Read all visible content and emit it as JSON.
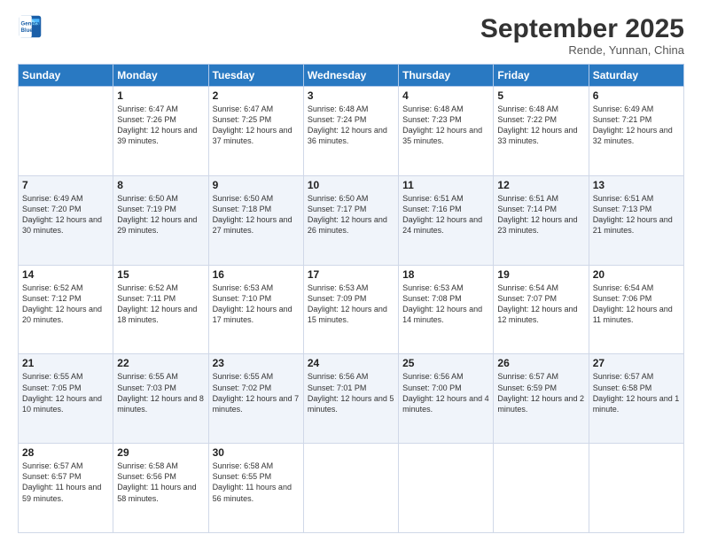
{
  "header": {
    "logo_line1": "General",
    "logo_line2": "Blue",
    "month_title": "September 2025",
    "subtitle": "Rende, Yunnan, China"
  },
  "weekdays": [
    "Sunday",
    "Monday",
    "Tuesday",
    "Wednesday",
    "Thursday",
    "Friday",
    "Saturday"
  ],
  "weeks": [
    [
      {
        "day": "",
        "content": ""
      },
      {
        "day": "1",
        "content": "Sunrise: 6:47 AM\nSunset: 7:26 PM\nDaylight: 12 hours\nand 39 minutes."
      },
      {
        "day": "2",
        "content": "Sunrise: 6:47 AM\nSunset: 7:25 PM\nDaylight: 12 hours\nand 37 minutes."
      },
      {
        "day": "3",
        "content": "Sunrise: 6:48 AM\nSunset: 7:24 PM\nDaylight: 12 hours\nand 36 minutes."
      },
      {
        "day": "4",
        "content": "Sunrise: 6:48 AM\nSunset: 7:23 PM\nDaylight: 12 hours\nand 35 minutes."
      },
      {
        "day": "5",
        "content": "Sunrise: 6:48 AM\nSunset: 7:22 PM\nDaylight: 12 hours\nand 33 minutes."
      },
      {
        "day": "6",
        "content": "Sunrise: 6:49 AM\nSunset: 7:21 PM\nDaylight: 12 hours\nand 32 minutes."
      }
    ],
    [
      {
        "day": "7",
        "content": "Sunrise: 6:49 AM\nSunset: 7:20 PM\nDaylight: 12 hours\nand 30 minutes."
      },
      {
        "day": "8",
        "content": "Sunrise: 6:50 AM\nSunset: 7:19 PM\nDaylight: 12 hours\nand 29 minutes."
      },
      {
        "day": "9",
        "content": "Sunrise: 6:50 AM\nSunset: 7:18 PM\nDaylight: 12 hours\nand 27 minutes."
      },
      {
        "day": "10",
        "content": "Sunrise: 6:50 AM\nSunset: 7:17 PM\nDaylight: 12 hours\nand 26 minutes."
      },
      {
        "day": "11",
        "content": "Sunrise: 6:51 AM\nSunset: 7:16 PM\nDaylight: 12 hours\nand 24 minutes."
      },
      {
        "day": "12",
        "content": "Sunrise: 6:51 AM\nSunset: 7:14 PM\nDaylight: 12 hours\nand 23 minutes."
      },
      {
        "day": "13",
        "content": "Sunrise: 6:51 AM\nSunset: 7:13 PM\nDaylight: 12 hours\nand 21 minutes."
      }
    ],
    [
      {
        "day": "14",
        "content": "Sunrise: 6:52 AM\nSunset: 7:12 PM\nDaylight: 12 hours\nand 20 minutes."
      },
      {
        "day": "15",
        "content": "Sunrise: 6:52 AM\nSunset: 7:11 PM\nDaylight: 12 hours\nand 18 minutes."
      },
      {
        "day": "16",
        "content": "Sunrise: 6:53 AM\nSunset: 7:10 PM\nDaylight: 12 hours\nand 17 minutes."
      },
      {
        "day": "17",
        "content": "Sunrise: 6:53 AM\nSunset: 7:09 PM\nDaylight: 12 hours\nand 15 minutes."
      },
      {
        "day": "18",
        "content": "Sunrise: 6:53 AM\nSunset: 7:08 PM\nDaylight: 12 hours\nand 14 minutes."
      },
      {
        "day": "19",
        "content": "Sunrise: 6:54 AM\nSunset: 7:07 PM\nDaylight: 12 hours\nand 12 minutes."
      },
      {
        "day": "20",
        "content": "Sunrise: 6:54 AM\nSunset: 7:06 PM\nDaylight: 12 hours\nand 11 minutes."
      }
    ],
    [
      {
        "day": "21",
        "content": "Sunrise: 6:55 AM\nSunset: 7:05 PM\nDaylight: 12 hours\nand 10 minutes."
      },
      {
        "day": "22",
        "content": "Sunrise: 6:55 AM\nSunset: 7:03 PM\nDaylight: 12 hours\nand 8 minutes."
      },
      {
        "day": "23",
        "content": "Sunrise: 6:55 AM\nSunset: 7:02 PM\nDaylight: 12 hours\nand 7 minutes."
      },
      {
        "day": "24",
        "content": "Sunrise: 6:56 AM\nSunset: 7:01 PM\nDaylight: 12 hours\nand 5 minutes."
      },
      {
        "day": "25",
        "content": "Sunrise: 6:56 AM\nSunset: 7:00 PM\nDaylight: 12 hours\nand 4 minutes."
      },
      {
        "day": "26",
        "content": "Sunrise: 6:57 AM\nSunset: 6:59 PM\nDaylight: 12 hours\nand 2 minutes."
      },
      {
        "day": "27",
        "content": "Sunrise: 6:57 AM\nSunset: 6:58 PM\nDaylight: 12 hours\nand 1 minute."
      }
    ],
    [
      {
        "day": "28",
        "content": "Sunrise: 6:57 AM\nSunset: 6:57 PM\nDaylight: 11 hours\nand 59 minutes."
      },
      {
        "day": "29",
        "content": "Sunrise: 6:58 AM\nSunset: 6:56 PM\nDaylight: 11 hours\nand 58 minutes."
      },
      {
        "day": "30",
        "content": "Sunrise: 6:58 AM\nSunset: 6:55 PM\nDaylight: 11 hours\nand 56 minutes."
      },
      {
        "day": "",
        "content": ""
      },
      {
        "day": "",
        "content": ""
      },
      {
        "day": "",
        "content": ""
      },
      {
        "day": "",
        "content": ""
      }
    ]
  ]
}
